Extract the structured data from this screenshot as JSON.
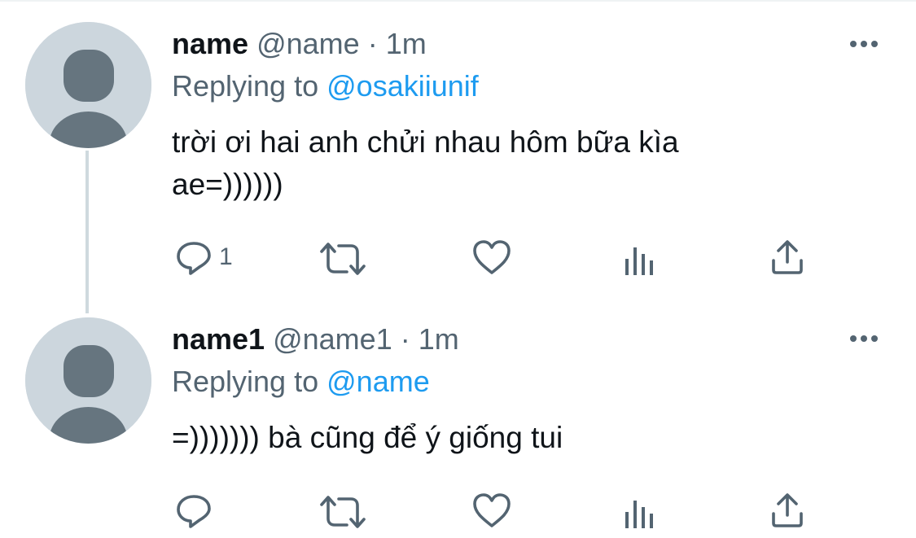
{
  "tweets": [
    {
      "display_name": "name",
      "handle": "@name",
      "separator": "·",
      "time": "1m",
      "replying_prefix": "Replying to",
      "replying_to": "@osakiiunif",
      "text_line1": "trời ơi hai anh chửi nhau hôm bữa kìa",
      "text_line2": "ae=))))))",
      "reply_count": "1"
    },
    {
      "display_name": "name1",
      "handle": "@name1",
      "separator": "·",
      "time": "1m",
      "replying_prefix": "Replying to",
      "replying_to": "@name",
      "text_line1": "=))))))) bà cũng để ý giống tui",
      "reply_count": ""
    }
  ],
  "icons": {
    "more": "more-horizontal-icon",
    "reply": "reply-icon",
    "retweet": "retweet-icon",
    "like": "heart-icon",
    "views": "views-icon",
    "share": "share-icon"
  },
  "colors": {
    "text_primary": "#0f1419",
    "text_secondary": "#536471",
    "link": "#1d9bf0",
    "avatar_bg": "#ccd6dd",
    "avatar_fg": "#66757f",
    "thread_line": "#cfd9de"
  }
}
